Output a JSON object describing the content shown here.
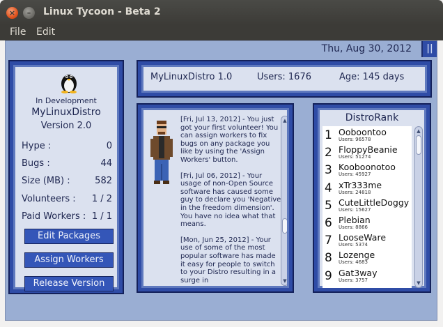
{
  "window": {
    "title": "Linux Tycoon - Beta 2",
    "close_glyph": "×",
    "min_glyph": "–"
  },
  "menu": {
    "file": "File",
    "edit": "Edit"
  },
  "header": {
    "date": "Thu, Aug 30, 2012",
    "side_glyph": "||"
  },
  "distro": {
    "status": "In Development",
    "name": "MyLinuxDistro",
    "version": "Version 2.0"
  },
  "stats": [
    {
      "label": "Hype :",
      "value": "0"
    },
    {
      "label": "Bugs :",
      "value": "44"
    },
    {
      "label": "Size (MB) :",
      "value": "582"
    },
    {
      "label": "Volunteers :",
      "value": "1 / 2"
    },
    {
      "label": "Paid Workers :",
      "value": "1 / 1"
    }
  ],
  "buttons": {
    "edit_packages": "Edit Packages",
    "assign_workers": "Assign Workers",
    "release_version": "Release Version"
  },
  "summary": {
    "distro_version": "MyLinuxDistro 1.0",
    "users": "Users: 1676",
    "age": "Age: 145 days"
  },
  "messages": [
    "[Fri, Jul 13, 2012] - You just got your first volunteer!  You can assign workers to fix bugs on any package you like by using the 'Assign Workers' button.",
    "[Fri, Jul 06, 2012] - Your usage of non-Open Source software has caused some guy to declare you 'Negative in the freedom dimension'.  You have no idea what that means.",
    "[Mon, Jun 25, 2012] - Your use of some of the most popular software has made it easy for people to switch to your Distro resulting in a surge in"
  ],
  "distrorank": {
    "title": "DistroRank",
    "entries": [
      {
        "rank": "1",
        "name": "Ooboontoo",
        "users": "Users: 96578"
      },
      {
        "rank": "2",
        "name": "FloppyBeanie",
        "users": "Users: 51274"
      },
      {
        "rank": "3",
        "name": "Kooboonotoo",
        "users": "Users: 45927"
      },
      {
        "rank": "4",
        "name": "xTr333me",
        "users": "Users: 24818"
      },
      {
        "rank": "5",
        "name": "CuteLittleDoggy",
        "users": "Users: 15627"
      },
      {
        "rank": "6",
        "name": "Plebian",
        "users": "Users: 8866"
      },
      {
        "rank": "7",
        "name": "LooseWare",
        "users": "Users: 5374"
      },
      {
        "rank": "8",
        "name": "Lozenge",
        "users": "Users: 4683"
      },
      {
        "rank": "9",
        "name": "Gat3way",
        "users": "Users: 3757"
      }
    ]
  },
  "icons": {
    "penguin": "penguin-icon",
    "worker": "worker-avatar"
  },
  "colors": {
    "background": "#9aaed3",
    "panel": "#2f4ca6",
    "button": "#3456b8"
  }
}
